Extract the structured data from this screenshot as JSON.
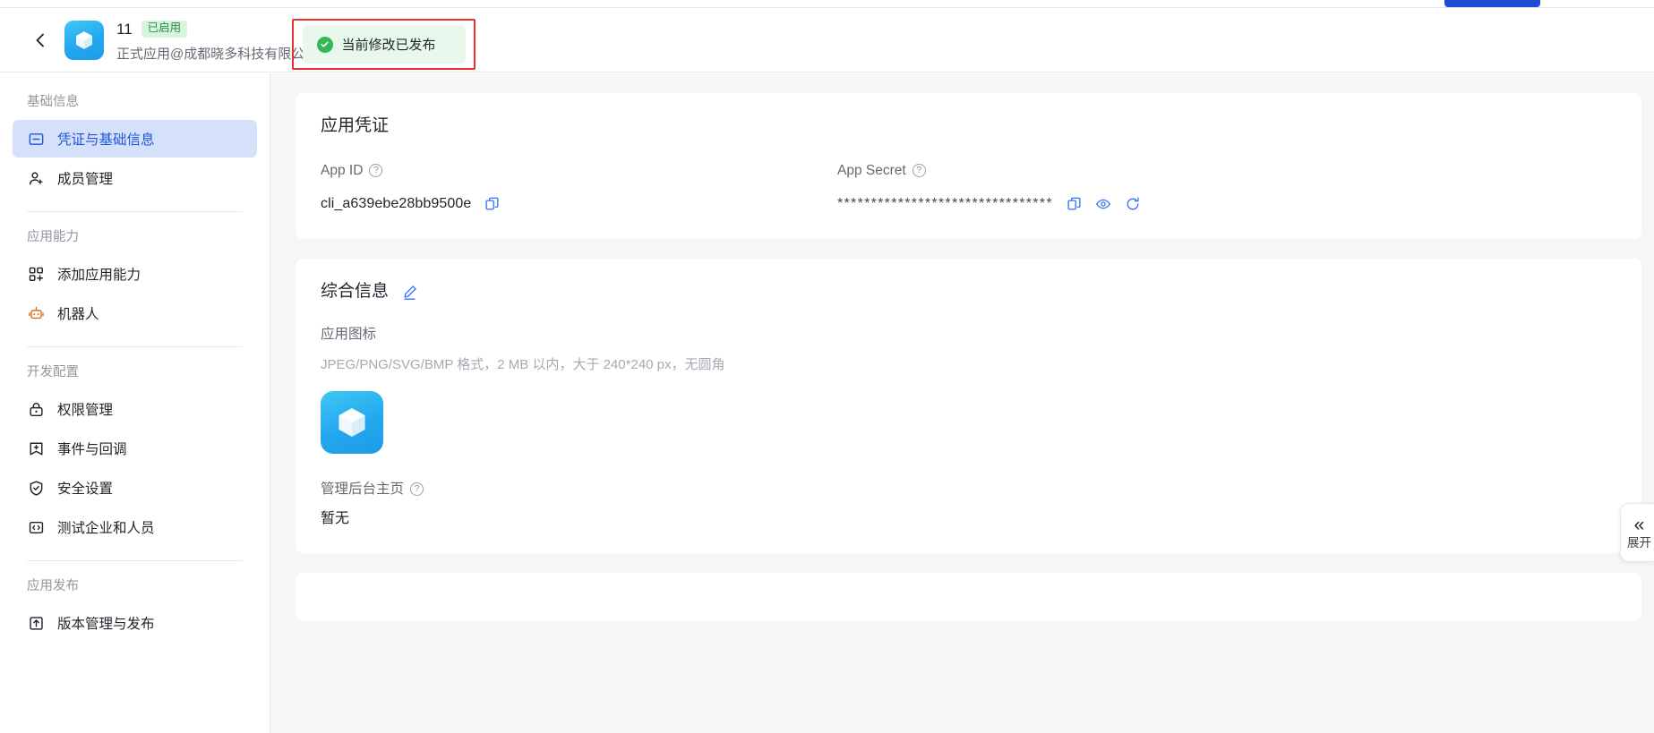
{
  "header": {
    "back_icon": "chevron-left-icon",
    "app_icon": "cube-app-icon",
    "app_name": "11",
    "status_badge": "已启用",
    "app_subtitle": "正式应用@成都晓多科技有限公司",
    "publish_status": "当前修改已发布",
    "publish_check_icon": "check-circle-icon",
    "annotation_color": "#e8312f"
  },
  "sidebar": {
    "groups": [
      {
        "title": "基础信息",
        "items": [
          {
            "label": "凭证与基础信息",
            "icon": "credential-icon",
            "active": true
          },
          {
            "label": "成员管理",
            "icon": "user-add-icon",
            "active": false
          }
        ]
      },
      {
        "title": "应用能力",
        "items": [
          {
            "label": "添加应用能力",
            "icon": "grid-add-icon",
            "active": false
          },
          {
            "label": "机器人",
            "icon": "robot-icon",
            "active": false
          }
        ]
      },
      {
        "title": "开发配置",
        "items": [
          {
            "label": "权限管理",
            "icon": "lock-icon",
            "active": false
          },
          {
            "label": "事件与回调",
            "icon": "event-add-icon",
            "active": false
          },
          {
            "label": "安全设置",
            "icon": "shield-check-icon",
            "active": false
          },
          {
            "label": "测试企业和人员",
            "icon": "code-icon",
            "active": false
          }
        ]
      },
      {
        "title": "应用发布",
        "items": [
          {
            "label": "版本管理与发布",
            "icon": "upload-box-icon",
            "active": false
          }
        ]
      }
    ]
  },
  "credentials_card": {
    "title": "应用凭证",
    "app_id_label": "App ID",
    "app_id_value": "cli_a639ebe28bb9500e",
    "app_id_copy_icon": "copy-icon",
    "app_secret_label": "App Secret",
    "app_secret_value": "********************************",
    "app_secret_copy_icon": "copy-icon",
    "app_secret_eye_icon": "eye-icon",
    "app_secret_refresh_icon": "refresh-icon",
    "help_icon": "question-mark-icon"
  },
  "info_card": {
    "title": "综合信息",
    "edit_icon": "pencil-edit-icon",
    "app_icon_label": "应用图标",
    "app_icon_hint": "JPEG/PNG/SVG/BMP 格式，2 MB 以内，大于 240*240 px，无圆角",
    "app_icon_preview": "cube-app-icon",
    "admin_home_label": "管理后台主页",
    "admin_home_value": "暂无",
    "help_icon": "question-mark-icon"
  },
  "expand_panel": {
    "icon": "double-chevron-left-icon",
    "label": "展开"
  },
  "colors": {
    "accent_blue": "#245bdb",
    "active_nav_bg": "#d5e0fb",
    "success_green": "#34b857",
    "badge_green_bg": "#d6f5dc",
    "page_bg": "#f5f6f7",
    "annotation_red": "#e8312f"
  }
}
